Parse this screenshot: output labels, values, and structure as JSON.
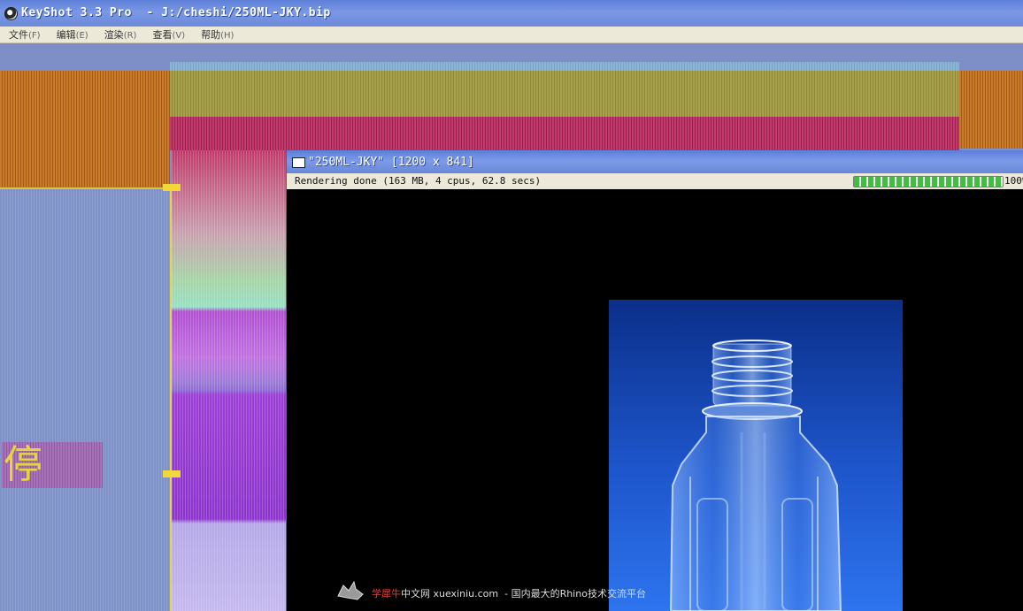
{
  "window": {
    "title": "KeyShot 3.3 Pro  - J:/cheshi/250ML-JKY.bip"
  },
  "menu": [
    {
      "label": "文件",
      "key": "(F)"
    },
    {
      "label": "编辑",
      "key": "(E)"
    },
    {
      "label": "渲染",
      "key": "(R)"
    },
    {
      "label": "查看",
      "key": "(V)"
    },
    {
      "label": "帮助",
      "key": "(H)"
    }
  ],
  "render_window": {
    "title": "\"250ML-JKY\" [1200 x 841]",
    "status": "Rendering done (163 MB, 4 cpus, 62.8 secs)",
    "progress_percent": 100,
    "progress_label": "100%"
  },
  "background_glyph": "停",
  "watermark": {
    "brand": "学犀牛",
    "rest": "中文网 xuexiniu.com  - 国内最大的Rhino技术交流平台"
  },
  "colors": {
    "titlebar": "#6c8ad9",
    "menubar": "#ece9d8",
    "progress": "#3fbf3f",
    "render_bg": "#1e56cc"
  }
}
